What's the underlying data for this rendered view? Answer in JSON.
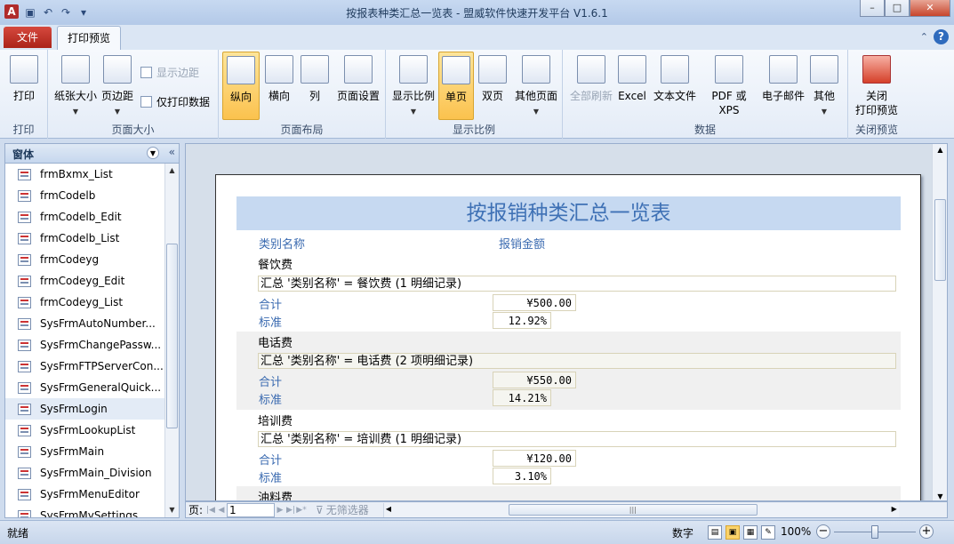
{
  "window": {
    "title": "按报表种类汇总一览表 - 盟威软件快速开发平台 V1.6.1",
    "controls": {
      "minimize": "–",
      "maximize": "□",
      "close": "✕"
    }
  },
  "tabs": {
    "file": "文件",
    "print_preview": "打印预览"
  },
  "ribbon": {
    "groups": {
      "print": "打印",
      "page_size": "页面大小",
      "page_layout": "页面布局",
      "zoom": "显示比例",
      "data": "数据",
      "close_preview": "关闭预览"
    },
    "buttons": {
      "print": "打印",
      "paper_size": "纸张大小",
      "margins": "页边距",
      "show_margins": "显示边距",
      "print_data_only": "仅打印数据",
      "portrait": "纵向",
      "landscape": "横向",
      "columns": "列",
      "page_setup": "页面设置",
      "zoom": "显示比例",
      "one_page": "单页",
      "two_pages": "双页",
      "more_pages": "其他页面",
      "refresh_all": "全部刷新",
      "excel": "Excel",
      "text_file": "文本文件",
      "pdf_xps": "PDF 或 XPS",
      "email": "电子邮件",
      "more": "其他",
      "close_preview_1": "关闭",
      "close_preview_2": "打印预览"
    }
  },
  "nav_pane": {
    "header": "窗体",
    "items": [
      "frmBxmx_List",
      "frmCodelb",
      "frmCodelb_Edit",
      "frmCodelb_List",
      "frmCodeyg",
      "frmCodeyg_Edit",
      "frmCodeyg_List",
      "SysFrmAutoNumber...",
      "SysFrmChangePassw...",
      "SysFrmFTPServerCon...",
      "SysFrmGeneralQuick...",
      "SysFrmLogin",
      "SysFrmLookupList",
      "SysFrmMain",
      "SysFrmMain_Division",
      "SysFrmMenuEditor",
      "SysFrmMySettings"
    ]
  },
  "report": {
    "title": "按报销种类汇总一览表",
    "col_category": "类别名称",
    "col_amount": "报销金额",
    "label_total": "合计",
    "label_standard": "标准",
    "groups": [
      {
        "name": "餐饮费",
        "summary": "汇总 '类别名称' =  餐饮费 (1 明细记录)",
        "total": "¥500.00",
        "standard": "12.92%"
      },
      {
        "name": "电话费",
        "summary": "汇总 '类别名称' =  电话费 (2 项明细记录)",
        "total": "¥550.00",
        "standard": "14.21%"
      },
      {
        "name": "培训费",
        "summary": "汇总 '类别名称' =  培训费 (1 明细记录)",
        "total": "¥120.00",
        "standard": "3.10%"
      },
      {
        "name": "油料费"
      }
    ]
  },
  "record_nav": {
    "label": "页:",
    "current": "1",
    "filter": "无筛选器"
  },
  "status": {
    "ready": "就绪",
    "num": "数字",
    "zoom": "100%"
  }
}
